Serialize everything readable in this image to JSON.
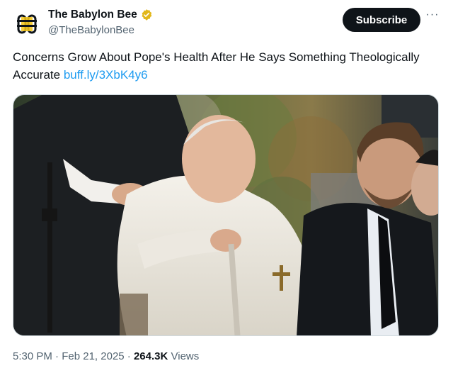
{
  "account": {
    "display_name": "The Babylon Bee",
    "handle": "@TheBabylonBee",
    "avatar_icon": "bee-logo-icon",
    "verified_icon": "verified-badge-icon",
    "verified_color": "#e2b719"
  },
  "actions": {
    "subscribe_label": "Subscribe",
    "more_label": "···"
  },
  "post": {
    "text": "Concerns Grow About Pope's Health After He Says Something Theologically Accurate",
    "link_text": "buff.ly/3XbK4y6",
    "link_color": "#1d9bf0"
  },
  "meta": {
    "time": "5:30 PM",
    "separator1": " · ",
    "date": "Feb 21, 2025",
    "separator2": " · ",
    "views_count": "264.3K",
    "views_label": " Views"
  }
}
